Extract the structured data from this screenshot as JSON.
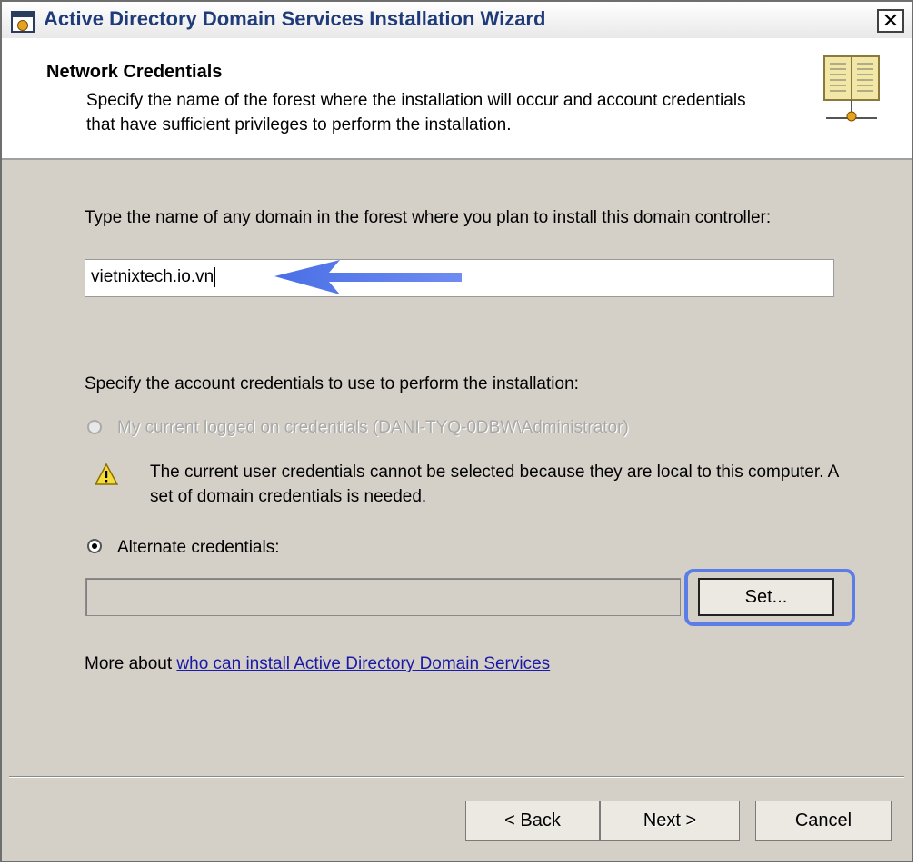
{
  "window": {
    "title": "Active Directory Domain Services Installation Wizard",
    "close_glyph": "✕"
  },
  "header": {
    "title": "Network Credentials",
    "description": "Specify the name of the forest where the installation will occur and account credentials that have sufficient privileges to perform the installation."
  },
  "domain": {
    "prompt": "Type the name of any domain in the forest where you plan to install this domain controller:",
    "value": "vietnixtech.io.vn"
  },
  "credentials": {
    "prompt": "Specify the account credentials to use to perform the installation:",
    "current_option": "My current logged on credentials (DANI-TYQ-0DBW\\Administrator)",
    "warning": "The current user credentials cannot be selected because they are local to this computer. A set of domain credentials is needed.",
    "alternate_option": "Alternate credentials:",
    "alternate_value": "",
    "set_button": "Set..."
  },
  "more": {
    "prefix": "More about ",
    "link": "who can install Active Directory Domain Services"
  },
  "footer": {
    "back": "< Back",
    "next": "Next >",
    "cancel": "Cancel"
  },
  "colors": {
    "highlight": "#5b7ee6",
    "link": "#1a1aa6",
    "title": "#1f3b7a"
  },
  "icons": {
    "window": "wizard-app-icon",
    "header": "directory-book-icon",
    "warning": "warning-triangle-icon",
    "annotation": "blue-arrow-annotation"
  }
}
